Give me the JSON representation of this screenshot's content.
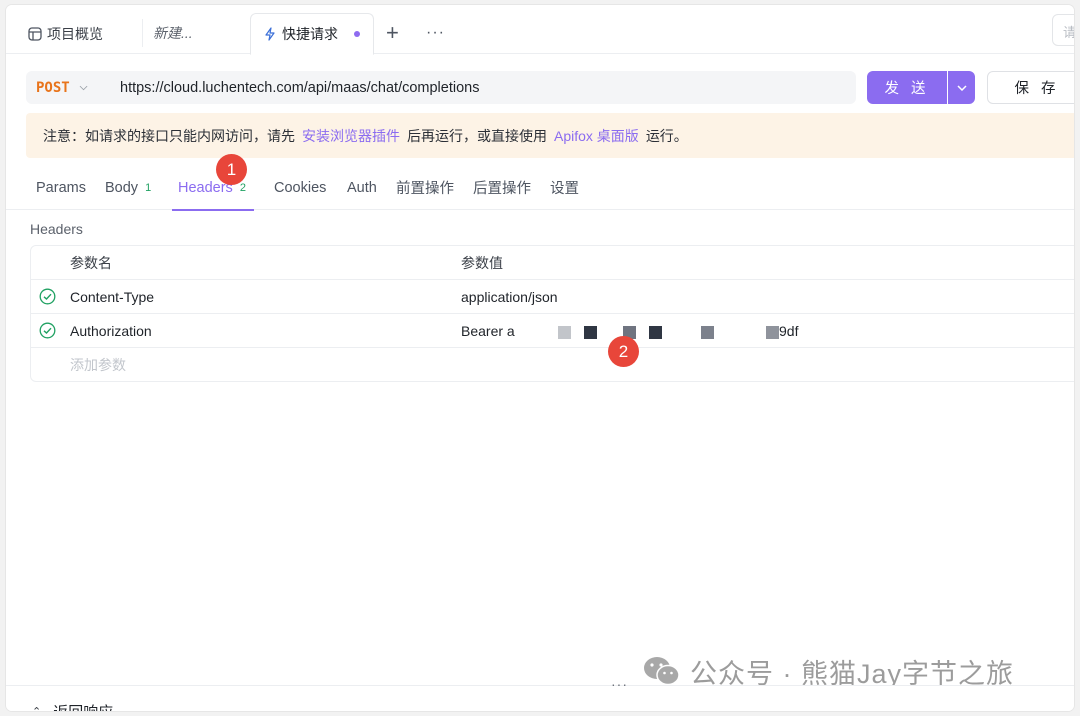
{
  "tabs": {
    "overview_label": "项目概览",
    "new_label": "新建...",
    "quick_label": "快捷请求",
    "plus_label": "+",
    "more_label": "···",
    "search_placeholder": "请"
  },
  "request": {
    "method": "POST",
    "url": "https://cloud.luchentech.com/api/maas/chat/completions",
    "send_label": "发 送",
    "save_label": "保 存"
  },
  "notice": {
    "prefix": "注意：如请求的接口只能内网访问，请先",
    "link1": "安装浏览器插件",
    "middle": "后再运行，或直接使用",
    "link2": "Apifox 桌面版",
    "suffix": "运行。"
  },
  "subtabs": {
    "params": "Params",
    "body": "Body",
    "body_count": "1",
    "headers": "Headers",
    "headers_count": "2",
    "cookies": "Cookies",
    "auth": "Auth",
    "pre_ops": "前置操作",
    "post_ops": "后置操作",
    "settings": "设置"
  },
  "headers_section": {
    "title": "Headers",
    "col_name": "参数名",
    "col_value": "参数值",
    "rows": [
      {
        "name": "Content-Type",
        "value": "application/json"
      },
      {
        "name": "Authorization",
        "value_prefix": "Bearer a",
        "value_suffix": "9df"
      }
    ],
    "add_placeholder": "添加参数"
  },
  "annotations": {
    "badge1": "1",
    "badge2": "2"
  },
  "bottom": {
    "handle": "···",
    "response_label": "返回响应"
  },
  "watermark": {
    "text": "公众号 · 熊猫Jay字节之旅"
  },
  "colors": {
    "accent": "#8b6cf0",
    "method": "#e8741b",
    "notice_bg": "#fdf3e6",
    "badge": "#e8463a",
    "success": "#20a162"
  }
}
